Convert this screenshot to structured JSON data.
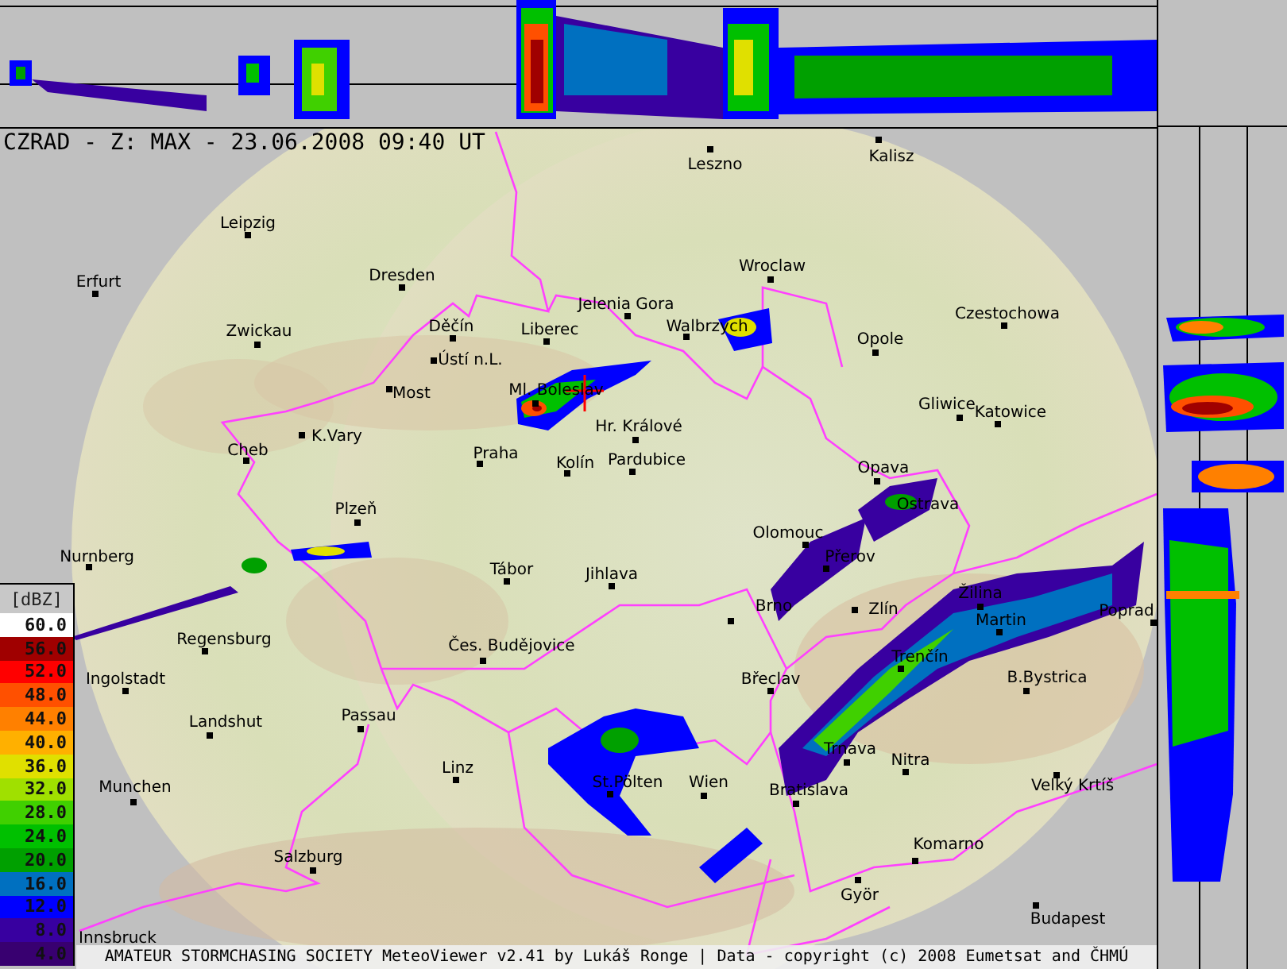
{
  "title": "CZRAD - Z: MAX - 23.06.2008 09:40 UT",
  "legend": {
    "unit": "[dBZ]",
    "levels": [
      {
        "label": "60.0",
        "color": "#ffffff"
      },
      {
        "label": "56.0",
        "color": "#a00000"
      },
      {
        "label": "52.0",
        "color": "#ff0000"
      },
      {
        "label": "48.0",
        "color": "#ff5000"
      },
      {
        "label": "44.0",
        "color": "#ff8000"
      },
      {
        "label": "40.0",
        "color": "#ffb000"
      },
      {
        "label": "36.0",
        "color": "#e0e000"
      },
      {
        "label": "32.0",
        "color": "#a0e000"
      },
      {
        "label": "28.0",
        "color": "#40d000"
      },
      {
        "label": "24.0",
        "color": "#00c000"
      },
      {
        "label": "20.0",
        "color": "#00a000"
      },
      {
        "label": "16.0",
        "color": "#0070c0"
      },
      {
        "label": "12.0",
        "color": "#0000ff"
      },
      {
        "label": "8.0",
        "color": "#3800a0"
      },
      {
        "label": "4.0",
        "color": "#380070"
      }
    ]
  },
  "cities": [
    {
      "name": "Leszno"
    },
    {
      "name": "Kalisz"
    },
    {
      "name": "Leipzig"
    },
    {
      "name": "Wroclaw"
    },
    {
      "name": "Erfurt"
    },
    {
      "name": "Dresden"
    },
    {
      "name": "Jelenia Gora"
    },
    {
      "name": "Czestochowa"
    },
    {
      "name": "Zwickau"
    },
    {
      "name": "Děčín"
    },
    {
      "name": "Liberec"
    },
    {
      "name": "Walbrzych"
    },
    {
      "name": "Opole"
    },
    {
      "name": "Ústí n.L."
    },
    {
      "name": "Most"
    },
    {
      "name": "Ml. Boleslav"
    },
    {
      "name": "Gliwice"
    },
    {
      "name": "Katowice"
    },
    {
      "name": "K.Vary"
    },
    {
      "name": "Hr. Králové"
    },
    {
      "name": "Cheb"
    },
    {
      "name": "Praha"
    },
    {
      "name": "Kolín"
    },
    {
      "name": "Pardubice"
    },
    {
      "name": "Opava"
    },
    {
      "name": "Plzeň"
    },
    {
      "name": "Ostrava"
    },
    {
      "name": "Olomouc"
    },
    {
      "name": "Nurnberg"
    },
    {
      "name": "Přerov"
    },
    {
      "name": "Tábor"
    },
    {
      "name": "Jihlava"
    },
    {
      "name": "Žilina"
    },
    {
      "name": "Brno"
    },
    {
      "name": "Zlín"
    },
    {
      "name": "Martin"
    },
    {
      "name": "Poprad"
    },
    {
      "name": "Regensburg"
    },
    {
      "name": "Čes. Budějovice"
    },
    {
      "name": "Trenčín"
    },
    {
      "name": "Ingolstadt"
    },
    {
      "name": "Břeclav"
    },
    {
      "name": "B.Bystrica"
    },
    {
      "name": "Landshut"
    },
    {
      "name": "Passau"
    },
    {
      "name": "Linz"
    },
    {
      "name": "Trnava"
    },
    {
      "name": "Nitra"
    },
    {
      "name": "Munchen"
    },
    {
      "name": "St.Pölten"
    },
    {
      "name": "Wien"
    },
    {
      "name": "Bratislava"
    },
    {
      "name": "Velký Krtíš"
    },
    {
      "name": "Salzburg"
    },
    {
      "name": "Komarno"
    },
    {
      "name": "Györ"
    },
    {
      "name": "Budapest"
    },
    {
      "name": "Innsbruck"
    }
  ],
  "footer": "AMATEUR STORMCHASING SOCIETY MeteoViewer v2.41 by Lukáš Ronge | Data - copyright (c) 2008 Eumetsat and ČHMÚ"
}
